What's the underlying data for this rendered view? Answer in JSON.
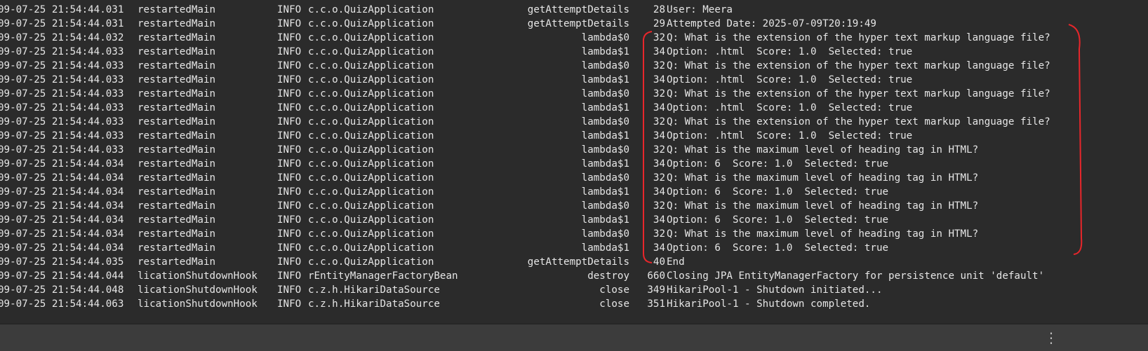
{
  "annotation": {
    "color": "#e8262b"
  },
  "status_bar": {
    "more_icon": "⋮"
  },
  "log_lines": [
    {
      "ts": "09-07-25 21:54:44.031",
      "thread": "restartedMain",
      "level": "INFO",
      "logger": "c.c.o.QuizApplication",
      "method": "getAttemptDetails",
      "line": "28",
      "msg": "User: Meera"
    },
    {
      "ts": "09-07-25 21:54:44.031",
      "thread": "restartedMain",
      "level": "INFO",
      "logger": "c.c.o.QuizApplication",
      "method": "getAttemptDetails",
      "line": "29",
      "msg": "Attempted Date: 2025-07-09T20:19:49"
    },
    {
      "ts": "09-07-25 21:54:44.032",
      "thread": "restartedMain",
      "level": "INFO",
      "logger": "c.c.o.QuizApplication",
      "method": "lambda$0",
      "line": "32",
      "msg": "Q: What is the extension of the hyper text markup language file?"
    },
    {
      "ts": "09-07-25 21:54:44.033",
      "thread": "restartedMain",
      "level": "INFO",
      "logger": "c.c.o.QuizApplication",
      "method": "lambda$1",
      "line": "34",
      "msg": "Option: .html  Score: 1.0  Selected: true"
    },
    {
      "ts": "09-07-25 21:54:44.033",
      "thread": "restartedMain",
      "level": "INFO",
      "logger": "c.c.o.QuizApplication",
      "method": "lambda$0",
      "line": "32",
      "msg": "Q: What is the extension of the hyper text markup language file?"
    },
    {
      "ts": "09-07-25 21:54:44.033",
      "thread": "restartedMain",
      "level": "INFO",
      "logger": "c.c.o.QuizApplication",
      "method": "lambda$1",
      "line": "34",
      "msg": "Option: .html  Score: 1.0  Selected: true"
    },
    {
      "ts": "09-07-25 21:54:44.033",
      "thread": "restartedMain",
      "level": "INFO",
      "logger": "c.c.o.QuizApplication",
      "method": "lambda$0",
      "line": "32",
      "msg": "Q: What is the extension of the hyper text markup language file?"
    },
    {
      "ts": "09-07-25 21:54:44.033",
      "thread": "restartedMain",
      "level": "INFO",
      "logger": "c.c.o.QuizApplication",
      "method": "lambda$1",
      "line": "34",
      "msg": "Option: .html  Score: 1.0  Selected: true"
    },
    {
      "ts": "09-07-25 21:54:44.033",
      "thread": "restartedMain",
      "level": "INFO",
      "logger": "c.c.o.QuizApplication",
      "method": "lambda$0",
      "line": "32",
      "msg": "Q: What is the extension of the hyper text markup language file?"
    },
    {
      "ts": "09-07-25 21:54:44.033",
      "thread": "restartedMain",
      "level": "INFO",
      "logger": "c.c.o.QuizApplication",
      "method": "lambda$1",
      "line": "34",
      "msg": "Option: .html  Score: 1.0  Selected: true"
    },
    {
      "ts": "09-07-25 21:54:44.033",
      "thread": "restartedMain",
      "level": "INFO",
      "logger": "c.c.o.QuizApplication",
      "method": "lambda$0",
      "line": "32",
      "msg": "Q: What is the maximum level of heading tag in HTML?"
    },
    {
      "ts": "09-07-25 21:54:44.034",
      "thread": "restartedMain",
      "level": "INFO",
      "logger": "c.c.o.QuizApplication",
      "method": "lambda$1",
      "line": "34",
      "msg": "Option: 6  Score: 1.0  Selected: true"
    },
    {
      "ts": "09-07-25 21:54:44.034",
      "thread": "restartedMain",
      "level": "INFO",
      "logger": "c.c.o.QuizApplication",
      "method": "lambda$0",
      "line": "32",
      "msg": "Q: What is the maximum level of heading tag in HTML?"
    },
    {
      "ts": "09-07-25 21:54:44.034",
      "thread": "restartedMain",
      "level": "INFO",
      "logger": "c.c.o.QuizApplication",
      "method": "lambda$1",
      "line": "34",
      "msg": "Option: 6  Score: 1.0  Selected: true"
    },
    {
      "ts": "09-07-25 21:54:44.034",
      "thread": "restartedMain",
      "level": "INFO",
      "logger": "c.c.o.QuizApplication",
      "method": "lambda$0",
      "line": "32",
      "msg": "Q: What is the maximum level of heading tag in HTML?"
    },
    {
      "ts": "09-07-25 21:54:44.034",
      "thread": "restartedMain",
      "level": "INFO",
      "logger": "c.c.o.QuizApplication",
      "method": "lambda$1",
      "line": "34",
      "msg": "Option: 6  Score: 1.0  Selected: true"
    },
    {
      "ts": "09-07-25 21:54:44.034",
      "thread": "restartedMain",
      "level": "INFO",
      "logger": "c.c.o.QuizApplication",
      "method": "lambda$0",
      "line": "32",
      "msg": "Q: What is the maximum level of heading tag in HTML?"
    },
    {
      "ts": "09-07-25 21:54:44.034",
      "thread": "restartedMain",
      "level": "INFO",
      "logger": "c.c.o.QuizApplication",
      "method": "lambda$1",
      "line": "34",
      "msg": "Option: 6  Score: 1.0  Selected: true"
    },
    {
      "ts": "09-07-25 21:54:44.035",
      "thread": "restartedMain",
      "level": "INFO",
      "logger": "c.c.o.QuizApplication",
      "method": "getAttemptDetails",
      "line": "40",
      "msg": "End"
    },
    {
      "ts": "09-07-25 21:54:44.044",
      "thread": "licationShutdownHook",
      "level": "INFO",
      "logger": "rEntityManagerFactoryBean",
      "method": "destroy",
      "line": "660",
      "msg": "Closing JPA EntityManagerFactory for persistence unit 'default'"
    },
    {
      "ts": "09-07-25 21:54:44.048",
      "thread": "licationShutdownHook",
      "level": "INFO",
      "logger": "c.z.h.HikariDataSource",
      "method": "close",
      "line": "349",
      "msg": "HikariPool-1 - Shutdown initiated..."
    },
    {
      "ts": "09-07-25 21:54:44.063",
      "thread": "licationShutdownHook",
      "level": "INFO",
      "logger": "c.z.h.HikariDataSource",
      "method": "close",
      "line": "351",
      "msg": "HikariPool-1 - Shutdown completed."
    }
  ]
}
